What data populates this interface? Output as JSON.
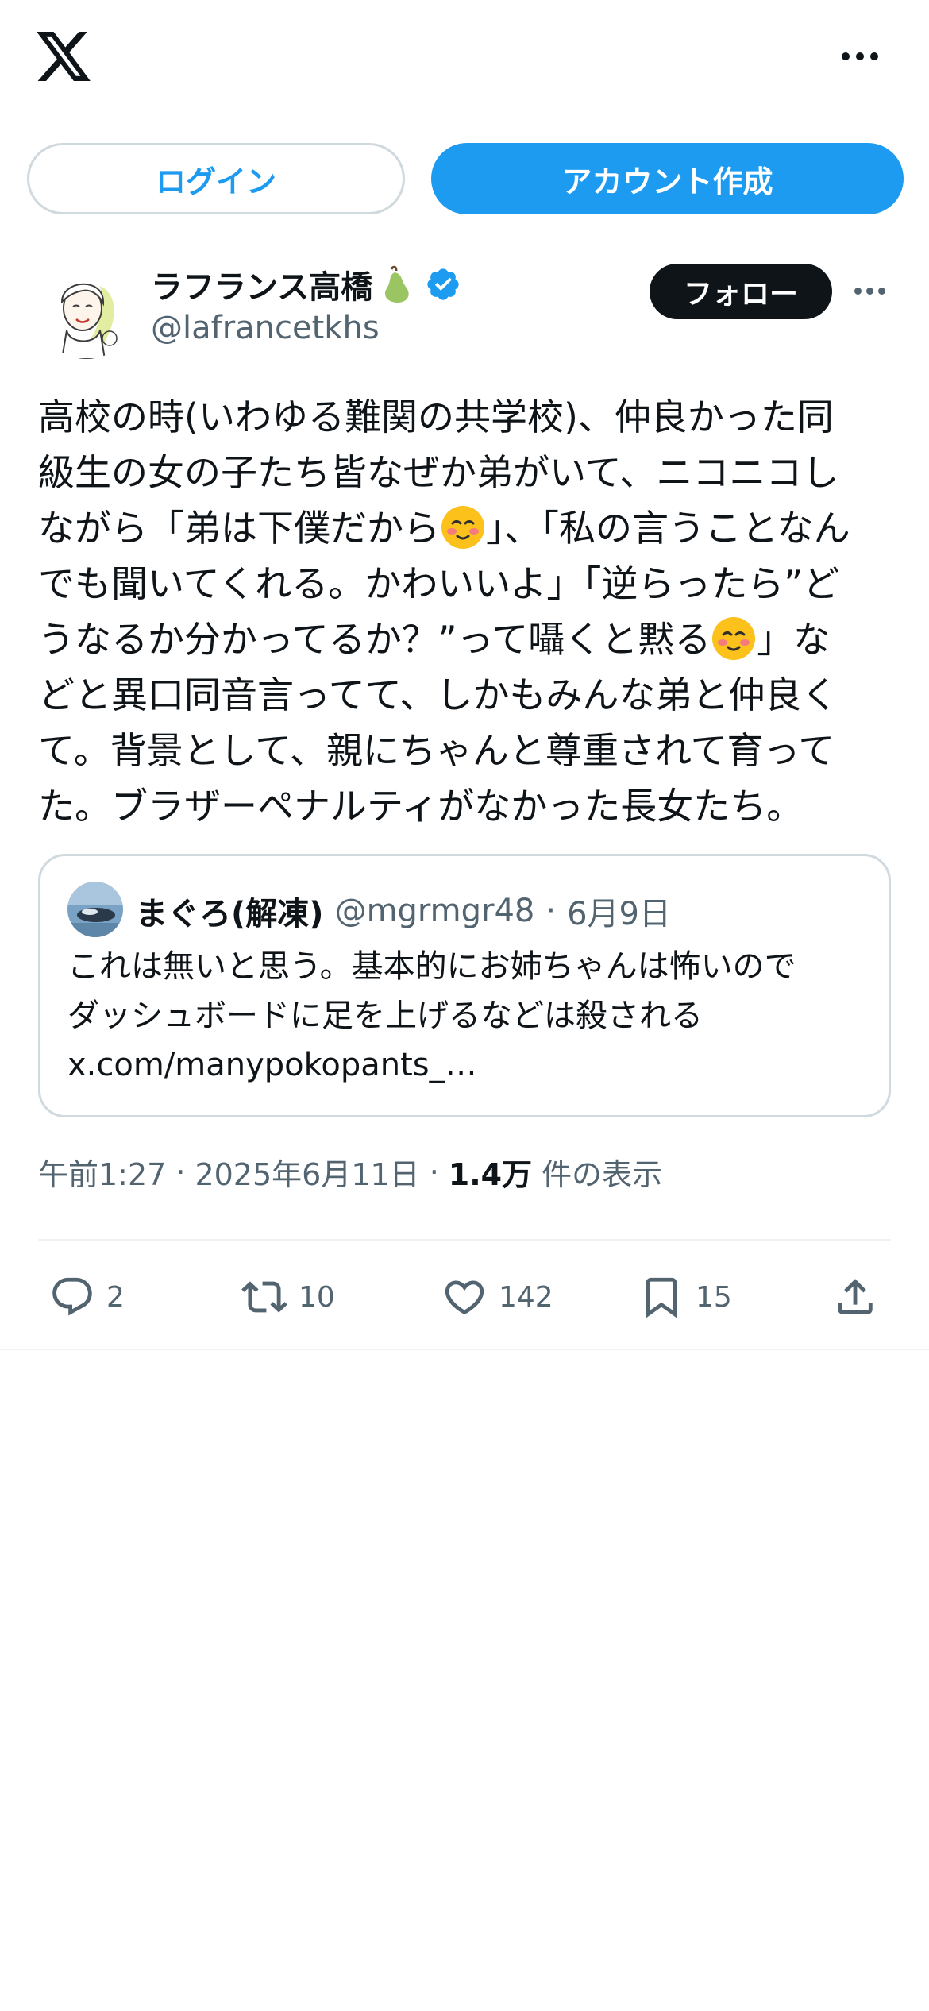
{
  "header": {
    "logo_icon": "x-logo-icon",
    "more_icon": "more-horizontal-icon"
  },
  "auth": {
    "login_label": "ログイン",
    "signup_label": "アカウント作成",
    "accent": "#1d9bf0"
  },
  "post": {
    "author_name": "ラフランス高橋",
    "author_handle": "@lafrancetkhs",
    "follow_label": "フォロー",
    "verified_icon": "verified-badge-icon",
    "body_parts": [
      "高校の時(いわゆる難関の共学校)、仲良かった同\n級生の女の子たち皆なぜか弟がいて、ニコニコし\nながら「弟は下僕だから",
      "」、「私の言うことなん\nでも聞いてくれる。かわいいよ」「逆らったら”ど\nうなるか分かってるか？”って囁くと黙る",
      "」な\nどと異口同音言ってて、しかもみんな弟と仲良く\nて。背景として、親にちゃんと尊重されて育って\nた。ブラザーペナルティがなかった長女たち。"
    ],
    "emoji_icon": "smiling-face-with-blush-emoji",
    "quote": {
      "name": "まぐろ(解凍)",
      "handle": "@mgrmgr48",
      "separator": "·",
      "date": "6月9日",
      "lines": [
        "これは無いと思う。基本的にお姉ちゃんは怖いので",
        "ダッシュボードに足を上げるなどは殺される",
        "x.com/manypokopants_…"
      ]
    },
    "meta": {
      "time": "午前1:27",
      "separator": "·",
      "date": "2025年6月11日",
      "views_count": "1.4万",
      "views_label": "件の表示"
    },
    "actions": {
      "replies": "2",
      "reposts": "10",
      "likes": "142",
      "bookmarks": "15"
    }
  }
}
